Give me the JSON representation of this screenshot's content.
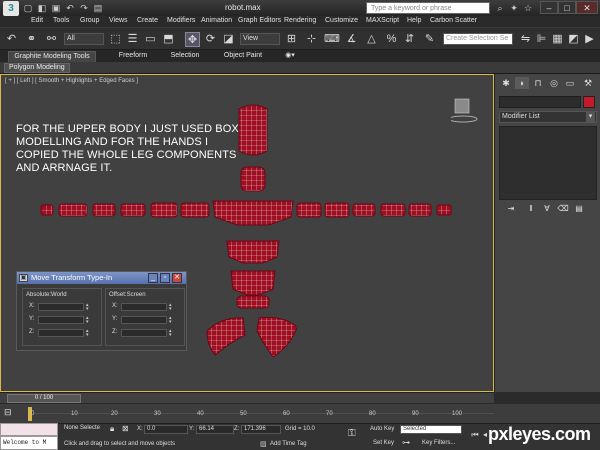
{
  "window": {
    "title": "robot.max",
    "search_placeholder": "Type a keyword or phrase"
  },
  "menu": [
    "Edit",
    "Tools",
    "Group",
    "Views",
    "Create",
    "Modifiers",
    "Animation",
    "Graph Editors",
    "Rendering",
    "Customize",
    "MAXScript",
    "Help",
    "Carbon Scatter"
  ],
  "toolbar": {
    "filter_value": "All",
    "refcoord_value": "View",
    "named_selection_placeholder": "Create Selection Se"
  },
  "ribbon": {
    "tabs": [
      "Graphite Modeling Tools",
      "Freeform",
      "Selection",
      "Object Paint"
    ],
    "panel_tab": "Polygon Modeling"
  },
  "viewport": {
    "label": "[ + ] [ Left ] [ Smooth + Highlights + Edged Faces ]",
    "overlay_text": "FOR THE UPPER BODY I JUST USED BOX MODELLING AND FOR THE HANDS I COPIED THE WHOLE LEG COMPONENTS AND ARRNAGE IT.",
    "wire_color": "#c8102e"
  },
  "dialog": {
    "title": "Move Transform Type-In",
    "absolute_label": "Absolute:World",
    "offset_label": "Offset:Screen",
    "axes": [
      "X:",
      "Y:",
      "Z:"
    ]
  },
  "command_panel": {
    "modifier_list": "Modifier List",
    "object_color": "#c21a2a"
  },
  "timeline": {
    "slider_label": "0 / 100",
    "ticks": [
      "0",
      "10",
      "20",
      "30",
      "40",
      "50",
      "60",
      "70",
      "80",
      "90",
      "100"
    ]
  },
  "status": {
    "maxscript_text": "Welcome to M",
    "selection": "None Selecte",
    "prompt": "Click and drag to select and move objects",
    "x_label": "X:",
    "x_value": "0.0",
    "y_label": "Y:",
    "y_value": "66.14",
    "z_label": "Z:",
    "z_value": "171.396",
    "grid": "Grid = 10.0",
    "add_time_tag": "Add Time Tag",
    "auto_key": "Auto Key",
    "auto_key_value": "Selected",
    "set_key": "Set Key",
    "key_filters": "Key Filters..."
  },
  "watermark": "pxleyes.com"
}
